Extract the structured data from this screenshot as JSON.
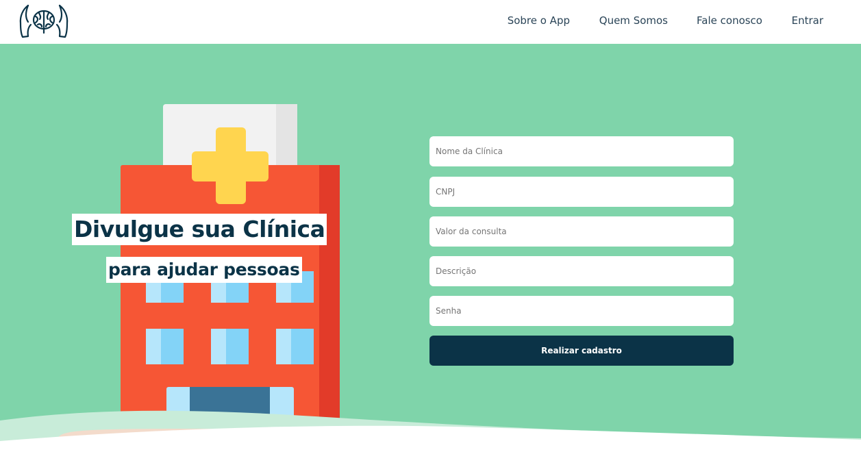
{
  "nav": {
    "links": [
      {
        "label": "Sobre o App"
      },
      {
        "label": "Quem Somos"
      },
      {
        "label": "Fale conosco"
      },
      {
        "label": "Entrar"
      }
    ]
  },
  "hero": {
    "headline": "Divulgue sua Clínica",
    "subheadline": "para ajudar pessoas"
  },
  "form": {
    "clinic_name_placeholder": "Nome da Clínica",
    "cnpj_placeholder": "CNPJ",
    "price_placeholder": "Valor da consulta",
    "description_placeholder": "Descrição",
    "password_placeholder": "Senha",
    "submit_label": "Realizar cadastro"
  },
  "colors": {
    "hero_background": "#7fd4aa",
    "primary_dark": "#0b3347",
    "nav_text": "#2a4457",
    "hospital_red": "#f65635",
    "cross_yellow": "#ffd54f"
  },
  "icons": {
    "logo": "hands-holding-brain-logo",
    "illustration": "hospital-building-illustration"
  }
}
